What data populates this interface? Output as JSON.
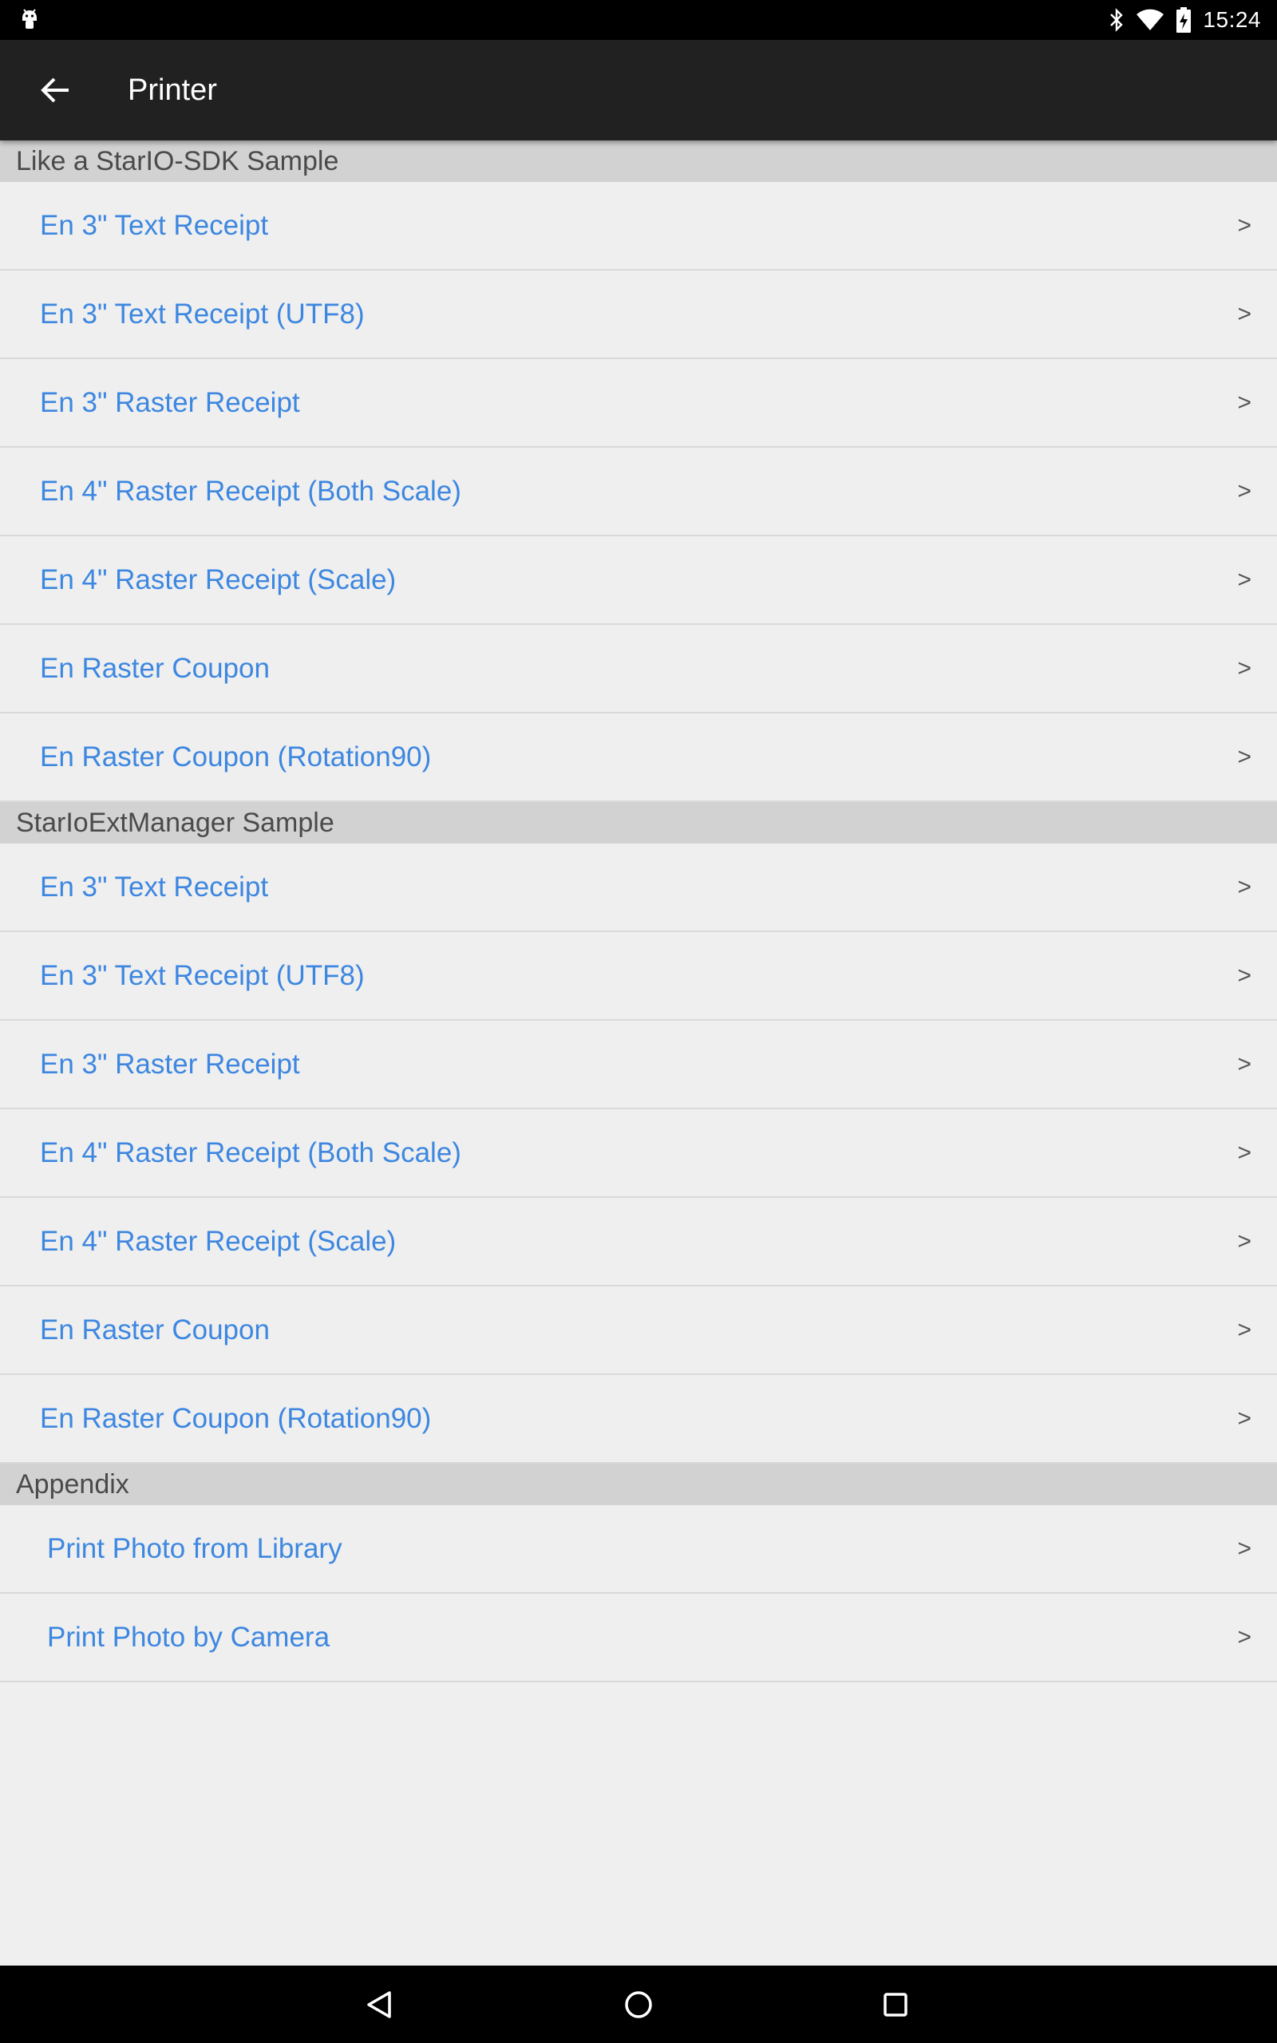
{
  "status_bar": {
    "time": "15:24",
    "icons": [
      "android-debug-icon",
      "bluetooth-icon",
      "wifi-icon",
      "battery-icon"
    ]
  },
  "app_bar": {
    "title": "Printer",
    "back_icon": "back-arrow-icon"
  },
  "colors": {
    "accent_text": "#3d87e0",
    "section_bg": "#d2d2d2",
    "app_bar_bg": "#212121",
    "page_bg": "#efefef"
  },
  "sections": [
    {
      "header": "Like a StarIO-SDK Sample",
      "items": [
        {
          "label": "En 3\" Text Receipt",
          "chevron": ">"
        },
        {
          "label": "En 3\" Text Receipt (UTF8)",
          "chevron": ">"
        },
        {
          "label": "En 3\" Raster Receipt",
          "chevron": ">"
        },
        {
          "label": "En 4\" Raster Receipt (Both Scale)",
          "chevron": ">"
        },
        {
          "label": "En 4\" Raster Receipt (Scale)",
          "chevron": ">"
        },
        {
          "label": "En Raster Coupon",
          "chevron": ">"
        },
        {
          "label": "En Raster Coupon (Rotation90)",
          "chevron": ">"
        }
      ]
    },
    {
      "header": "StarIoExtManager Sample",
      "items": [
        {
          "label": "En 3\" Text Receipt",
          "chevron": ">"
        },
        {
          "label": "En 3\" Text Receipt (UTF8)",
          "chevron": ">"
        },
        {
          "label": "En 3\" Raster Receipt",
          "chevron": ">"
        },
        {
          "label": "En 4\" Raster Receipt (Both Scale)",
          "chevron": ">"
        },
        {
          "label": "En 4\" Raster Receipt (Scale)",
          "chevron": ">"
        },
        {
          "label": "En Raster Coupon",
          "chevron": ">"
        },
        {
          "label": "En Raster Coupon (Rotation90)",
          "chevron": ">"
        }
      ]
    },
    {
      "header": "Appendix",
      "items": [
        {
          "label": "Print Photo from Library",
          "chevron": ">"
        },
        {
          "label": "Print Photo by Camera",
          "chevron": ">"
        }
      ]
    }
  ],
  "nav_bar": {
    "icons": [
      "nav-back-icon",
      "nav-home-icon",
      "nav-recents-icon"
    ]
  }
}
